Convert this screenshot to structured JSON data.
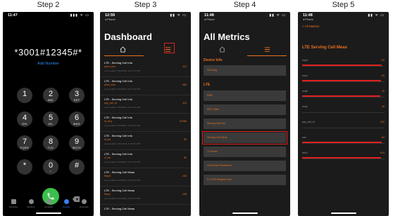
{
  "steps": [
    "Step 2",
    "Step 3",
    "Step 4",
    "Step 5"
  ],
  "phone1": {
    "time": "11:47",
    "dial_number": "*3001#12345#*",
    "add_number": "Add Number",
    "keys": [
      {
        "d": "1",
        "l": ""
      },
      {
        "d": "2",
        "l": "ABC"
      },
      {
        "d": "3",
        "l": "DEF"
      },
      {
        "d": "4",
        "l": "GHI"
      },
      {
        "d": "5",
        "l": "JKL"
      },
      {
        "d": "6",
        "l": "MNO"
      },
      {
        "d": "7",
        "l": "PQRS"
      },
      {
        "d": "8",
        "l": "TUV"
      },
      {
        "d": "9",
        "l": "WXYZ"
      },
      {
        "d": "*",
        "l": ""
      },
      {
        "d": "0",
        "l": "+"
      },
      {
        "d": "#",
        "l": ""
      }
    ],
    "tabs": [
      "Favorites",
      "Recents",
      "Contacts",
      "Keypad",
      "Voicemail"
    ],
    "active_tab": 3
  },
  "phone2": {
    "time": "12:59",
    "back": "◂ Phone",
    "title": "Dashboard",
    "rows": [
      {
        "t": "LTE - Serving Cell Info",
        "s": "plmn_mcc",
        "u": "Last updated: 6/02/2021 12:47:36 PDT",
        "v": "311"
      },
      {
        "t": "LTE - Serving Cell Info",
        "s": "plmn_mnc",
        "u": "Last updated: 6/02/2021 12:47:36 PDT",
        "v": "480"
      },
      {
        "t": "LTE - Serving Cell Info",
        "s": "phy_cell_id",
        "u": "Last updated: 6/02/2021 12:47:36 PDT",
        "v": "410"
      },
      {
        "t": "LTE - Serving Cell Info",
        "s": "dl_freq",
        "u": "Last updated: 6/02/2021 12:47:36 PDT",
        "v": "67086"
      },
      {
        "t": "LTE - Serving Cell Info",
        "s": "dl_bw",
        "u": "Last updated: 6/02/2021 12:47:36 PDT",
        "v": "50"
      },
      {
        "t": "LTE - Serving Cell Info",
        "s": "ul_bw",
        "u": "Last updated: 6/02/2021 12:47:36 PDT",
        "v": "50"
      },
      {
        "t": "LTE - Serving Cell Meas",
        "s": "Rsrp0",
        "u": "Last updated: 6/02/2021 12:59:10 PDT",
        "v": "-106"
      },
      {
        "t": "LTE - Serving Cell Meas",
        "s": "Rsrp1",
        "u": "Last updated: 6/02/2021 12:59:10 PDT",
        "v": "-108"
      },
      {
        "t": "LTE - Serving Cell Meas",
        "s": "",
        "u": "",
        "v": ""
      }
    ]
  },
  "phone3": {
    "time": "11:48",
    "back": "◂ Phone",
    "title": "All Metrics",
    "section1": "Device Info",
    "items1": [
      "Ota Diag"
    ],
    "section2": "LTE",
    "items2": [
      "RAB",
      "RRC State",
      "Serving Cell Info",
      "Serving Cell Meas",
      "Tx Power",
      "Cell Reset Parameters",
      "E-UTRA Neighbor Info"
    ],
    "highlight_index": 3
  },
  "phone4": {
    "time": "11:48",
    "back": "◂ Phone",
    "back_link": "< All Metrics",
    "title": "LTE Serving Cell Meas",
    "rows": [
      {
        "k": "rsrp0",
        "v": "-92",
        "bar": 0.97
      },
      {
        "k": "rsrp1",
        "v": "-93",
        "bar": 0.96
      },
      {
        "k": "rsrq0",
        "v": "-10",
        "bar": 0.95
      },
      {
        "k": "rsrq1",
        "v": "-16",
        "bar": 0
      },
      {
        "k": "phy_cell_id",
        "v": "262",
        "bar": 0
      },
      {
        "k": "rssi",
        "v": "-62",
        "bar": 0.97
      },
      {
        "k": "sinr0",
        "v": "10.6",
        "bar": 0.96
      }
    ]
  }
}
